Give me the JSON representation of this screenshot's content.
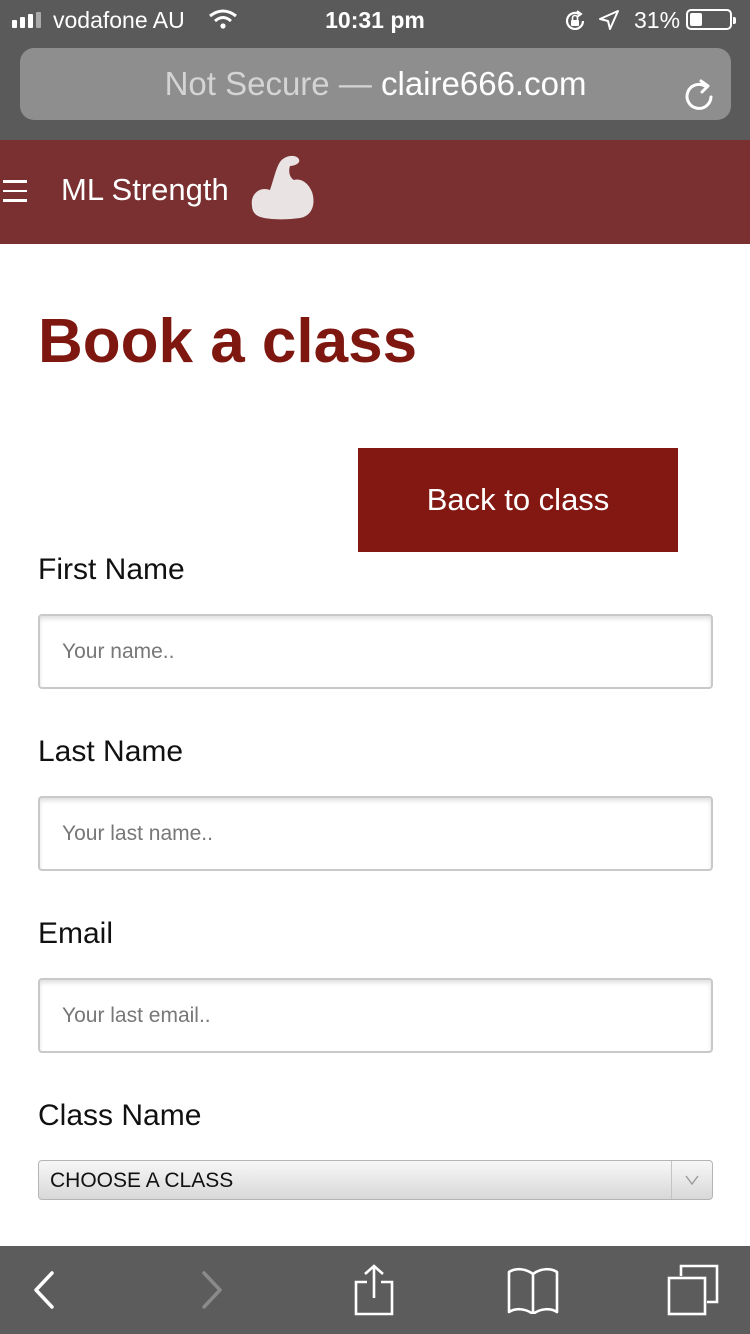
{
  "status_bar": {
    "carrier": "vodafone AU",
    "time": "10:31 pm",
    "battery_percent": "31%",
    "battery_level": 0.31
  },
  "browser": {
    "insecure_label": "Not Secure",
    "separator": " — ",
    "domain": "claire666.com"
  },
  "nav": {
    "brand": "ML Strength"
  },
  "page": {
    "title": "Book a class",
    "back_button": "Back to class"
  },
  "form": {
    "first_name": {
      "label": "First Name",
      "placeholder": "Your name..",
      "value": ""
    },
    "last_name": {
      "label": "Last Name",
      "placeholder": "Your last name..",
      "value": ""
    },
    "email": {
      "label": "Email",
      "placeholder": "Your last email..",
      "value": ""
    },
    "class_name": {
      "label": "Class Name",
      "selected": "CHOOSE A CLASS"
    }
  },
  "colors": {
    "brand_nav": "#7a3030",
    "accent": "#821811",
    "title": "#7e1710"
  },
  "icons": {
    "nav": [
      "hamburger-icon",
      "flexed-arm-icon"
    ],
    "toolbar": [
      "back-icon",
      "forward-icon",
      "share-icon",
      "bookmarks-icon",
      "tabs-icon"
    ]
  }
}
